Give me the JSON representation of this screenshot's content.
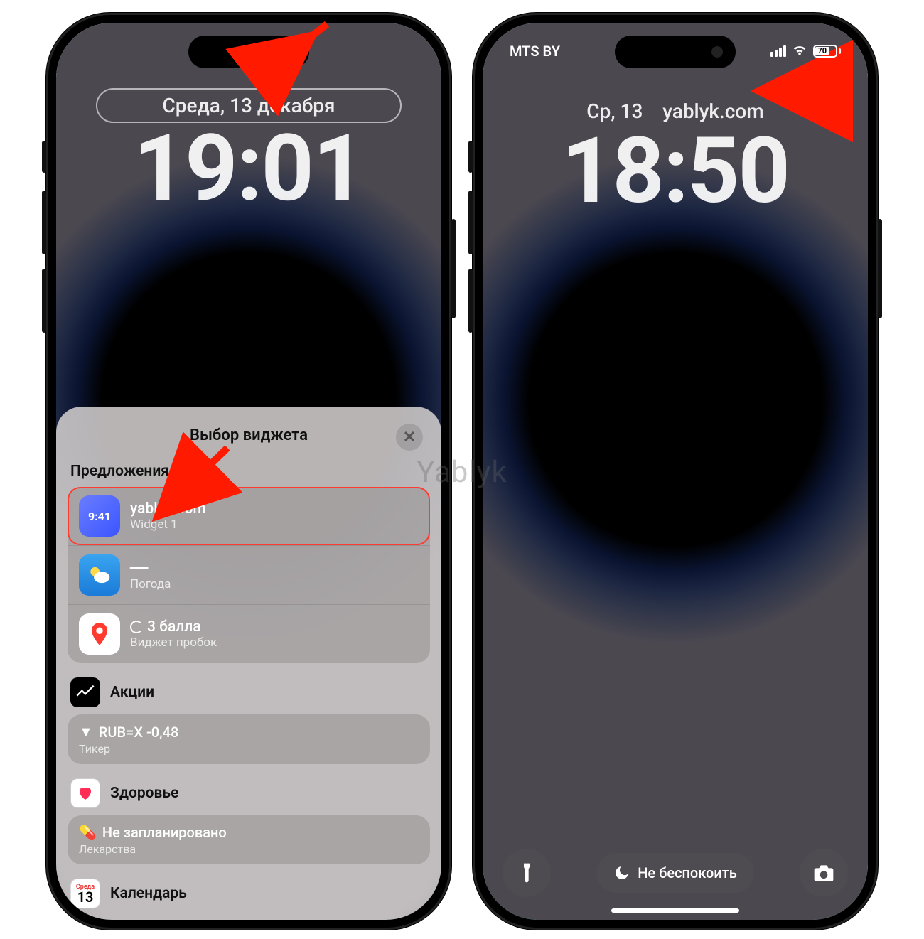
{
  "watermark": "Yablyk",
  "left_phone": {
    "date_pill": "Среда, 13 декабря",
    "time": "19:01",
    "sheet": {
      "title": "Выбор виджета",
      "section_suggestions": "Предложения",
      "widget1": {
        "title": "yablyk.com",
        "subtitle": "Widget 1",
        "badge": "9:41"
      },
      "weather": {
        "title": "━━",
        "subtitle": "Погода"
      },
      "traffic": {
        "title": "3 балла",
        "subtitle": "Виджет пробок"
      },
      "stocks": {
        "app": "Акции",
        "ticker": "RUB=X -0,48",
        "ticker_sub": "Тикер"
      },
      "health": {
        "app": "Здоровье",
        "row_title": "Не запланировано",
        "row_sub": "Лекарства"
      },
      "calendar": {
        "app": "Календарь",
        "icon_top": "Среда",
        "icon_num": "13"
      }
    }
  },
  "right_phone": {
    "status": {
      "carrier": "MTS BY",
      "battery": "70"
    },
    "date": "Ср, 13",
    "widget_text": "yablyk.com",
    "time": "18:50",
    "focus": "Не беспокоить"
  }
}
